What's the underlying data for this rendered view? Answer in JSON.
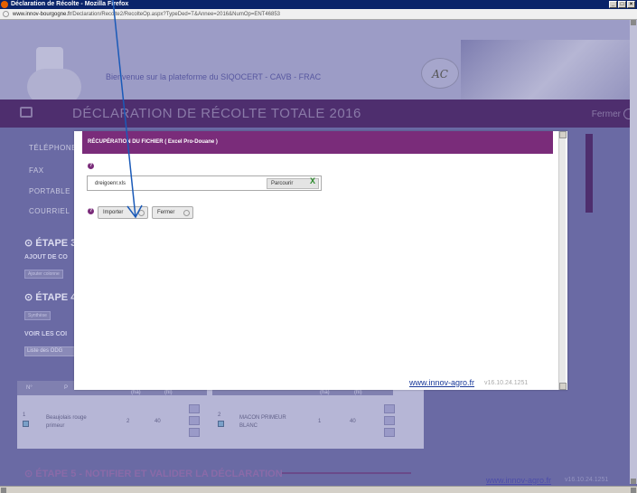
{
  "browser": {
    "window_title": "Déclaration de Récolte - Mozilla Firefox",
    "url_host": "www.innov-bourgogne.fr",
    "url_path": "/Declaration/Recolte2/RecolteOp.aspx?TypeDed=T&Annee=2016&NumOp=ENT46853"
  },
  "banner": {
    "welcome": "Bienvenue sur la plateforme du SIQOCERT - CAVB - FRAC",
    "acc_logo": "AC"
  },
  "header": {
    "title": "DÉCLARATION DE RÉCOLTE TOTALE 2016",
    "fermer": "Fermer"
  },
  "background": {
    "contacts": [
      "TÉLÉPHONE",
      "FAX",
      "PORTABLE",
      "COURRIEL"
    ],
    "step3": "ÉTAPE 3",
    "ajout": "AJOUT DE CO",
    "ajouter_btn": "Ajouter colonne",
    "step4": "ÉTAPE 4",
    "synthese_btn": "Synthèse",
    "voir": "VOIR LES COI",
    "liste": "Liste des ODG",
    "table": {
      "col1": "N°",
      "col2": "P",
      "unit1": "(ha)",
      "unit2": "(hl)",
      "unit3": "(ha)",
      "unit4": "(hl)",
      "row1_num": "1",
      "row1_name": "Beaujolais rouge primeur",
      "row1_v1": "2",
      "row1_v2": "40",
      "row2_num": "2",
      "row2_name": "MACON PRIMEUR BLANC",
      "row2_v1": "1",
      "row2_v2": "40"
    },
    "step5": "ÉTAPE 5 - NOTIFIER ET VALIDER LA DÉCLARATION",
    "footer_url": "www.innov-agro.fr",
    "footer_version": "v16.10.24.1251"
  },
  "modal": {
    "title": "RÉCUPÉRATION DU FICHIER ( Excel Pro-Douane )",
    "file_name": "dreigoenr.xls",
    "browse_label": "Parcourir",
    "import_label": "Importer",
    "close_label": "Fermer",
    "footer_url": "www.innov-agro.fr",
    "footer_version": "v16.10.24.1251"
  },
  "colors": {
    "modal_header": "#7a2c7a",
    "page_header": "#4e2e6e",
    "overlay": "#6a6aa4",
    "arrow": "#1a5ab8"
  }
}
